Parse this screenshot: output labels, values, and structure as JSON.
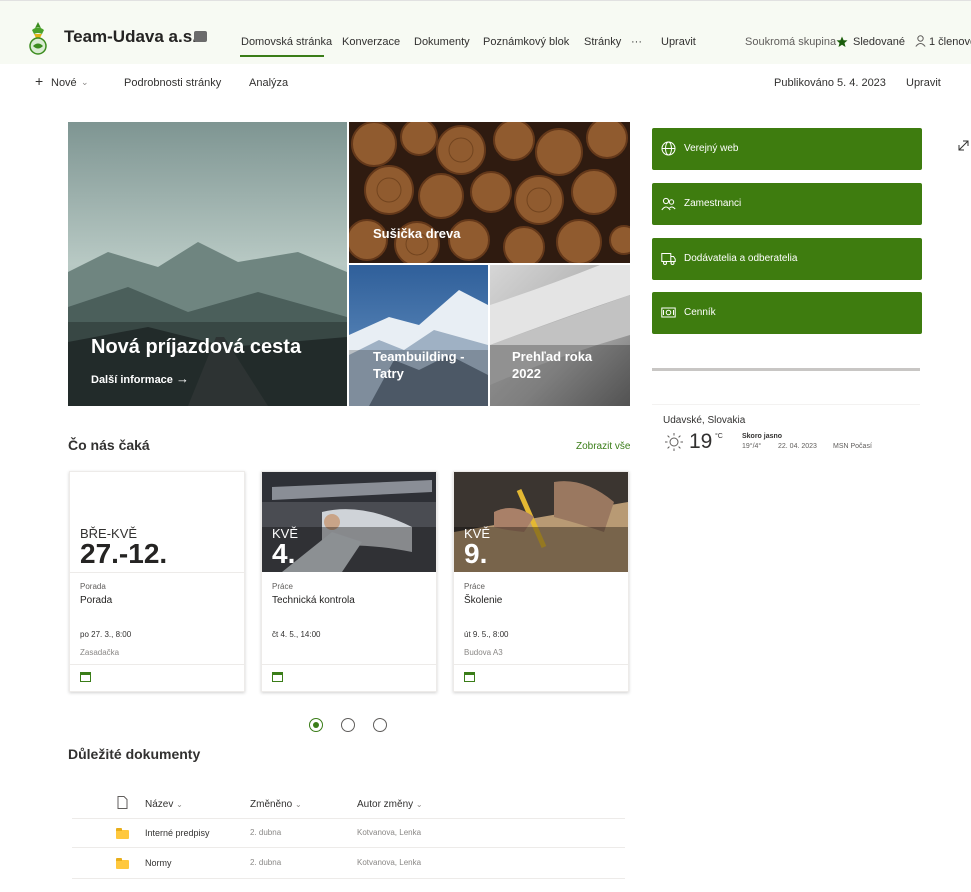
{
  "header": {
    "site_title": "Team-Udava a.s.",
    "nav": [
      "Domovská stránka",
      "Konverzace",
      "Dokumenty",
      "Poznámkový blok",
      "Stránky",
      "···",
      "Upravit"
    ],
    "privacy": "Soukromá skupina",
    "follow": "Sledované",
    "members": "1 členové"
  },
  "commandbar": {
    "new": "Nové",
    "page_details": "Podrobnosti stránky",
    "analytics": "Analýza",
    "published": "Publikováno 5. 4. 2023",
    "edit": "Upravit"
  },
  "hero": {
    "main_title": "Nová príjazdová cesta",
    "main_link": "Další informace",
    "tile1": "Sušička dreva",
    "tile2": "Teambuilding -Tatry",
    "tile3": "Prehľad roka 2022"
  },
  "quick_links": [
    {
      "label": "Verejný web",
      "icon": "globe-icon"
    },
    {
      "label": "Zamestnanci",
      "icon": "people-icon"
    },
    {
      "label": "Dodávatelia a odberatelia",
      "icon": "truck-icon"
    },
    {
      "label": "Cenník",
      "icon": "money-icon"
    }
  ],
  "weather": {
    "location": "Udavské, Slovakia",
    "temp": "19",
    "unit": "°C",
    "condition": "Skoro jasno",
    "hilo": "19°/4°",
    "date": "22. 04. 2023",
    "source": "MSN Počasí"
  },
  "events": {
    "title": "Čo nás čaká",
    "see_all": "Zobrazit vše",
    "items": [
      {
        "month": "BŘE-KVĚ",
        "day": "27.-12.",
        "category": "Porada",
        "title": "Porada",
        "when": "po 27. 3., 8:00",
        "where": "Zasadačka"
      },
      {
        "month": "KVĚ",
        "day": "4.",
        "category": "Práce",
        "title": "Technická kontrola",
        "when": "čt 4. 5., 14:00",
        "where": ""
      },
      {
        "month": "KVĚ",
        "day": "9.",
        "category": "Práce",
        "title": "Školenie",
        "when": "út 9. 5., 8:00",
        "where": "Budova A3"
      }
    ]
  },
  "documents": {
    "title": "Důležité dokumenty",
    "columns": [
      "Název",
      "Změněno",
      "Autor změny"
    ],
    "rows": [
      {
        "name": "Interné predpisy",
        "modified": "2. dubna",
        "author": "Kotvanova, Lenka"
      },
      {
        "name": "Normy",
        "modified": "2. dubna",
        "author": "Kotvanova, Lenka"
      }
    ]
  },
  "colors": {
    "accent": "#3a7d18",
    "quick_link_bg": "#3e7c0f",
    "header_bg": "#f7faf3"
  }
}
